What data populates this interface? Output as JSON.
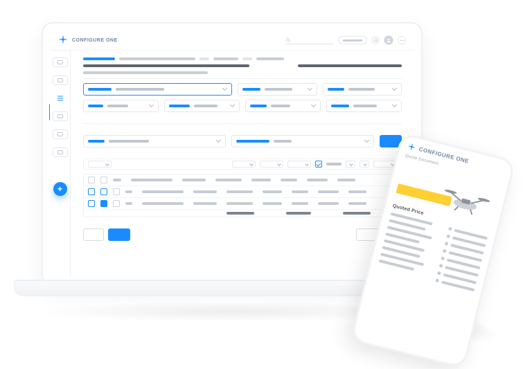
{
  "brand": {
    "name": "CONFIGURE ONE"
  },
  "sidebar": {
    "fab_glyph": "+",
    "items": [
      {
        "id": "dashboard"
      },
      {
        "id": "orders"
      },
      {
        "id": "quotes"
      },
      {
        "id": "products"
      },
      {
        "id": "reports"
      },
      {
        "id": "settings"
      }
    ]
  },
  "mobile": {
    "brand": "CONFIGURE ONE",
    "subtitle": "Quote Document",
    "section": "Quoted Price"
  }
}
